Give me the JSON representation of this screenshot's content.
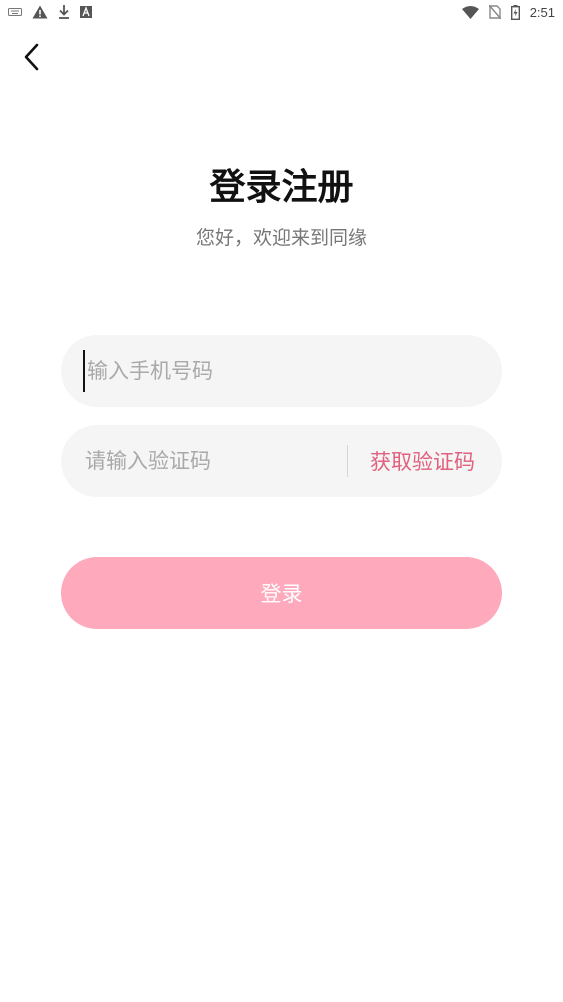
{
  "status_bar": {
    "time": "2:51",
    "left_icons": [
      "keyboard-icon",
      "warning-icon",
      "download-icon",
      "text-box-icon"
    ],
    "right_icons": [
      "wifi-icon",
      "no-sim-icon",
      "battery-icon"
    ]
  },
  "header": {
    "back_icon": "chevron-left-icon"
  },
  "page": {
    "title": "登录注册",
    "subtitle": "您好，欢迎来到同缘"
  },
  "form": {
    "phone_placeholder": "输入手机号码",
    "phone_value": "",
    "code_placeholder": "请输入验证码",
    "code_value": "",
    "get_code_label": "获取验证码",
    "login_label": "登录"
  },
  "colors": {
    "accent": "#e0607e",
    "login_button": "#ffa9bd",
    "field_background": "#f5f5f5"
  }
}
